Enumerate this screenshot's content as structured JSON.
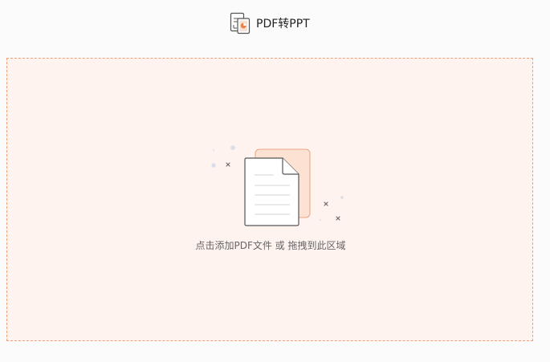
{
  "header": {
    "title": "PDF转PPT",
    "icon": "pdf-to-ppt-icon"
  },
  "dropzone": {
    "hint": "点击添加PDF文件 或 拖拽到此区域",
    "icon": "document-stack-icon"
  },
  "colors": {
    "accent": "#f0a077",
    "dropzone_bg": "#fff3f0",
    "back_page": "#fde2d4"
  }
}
